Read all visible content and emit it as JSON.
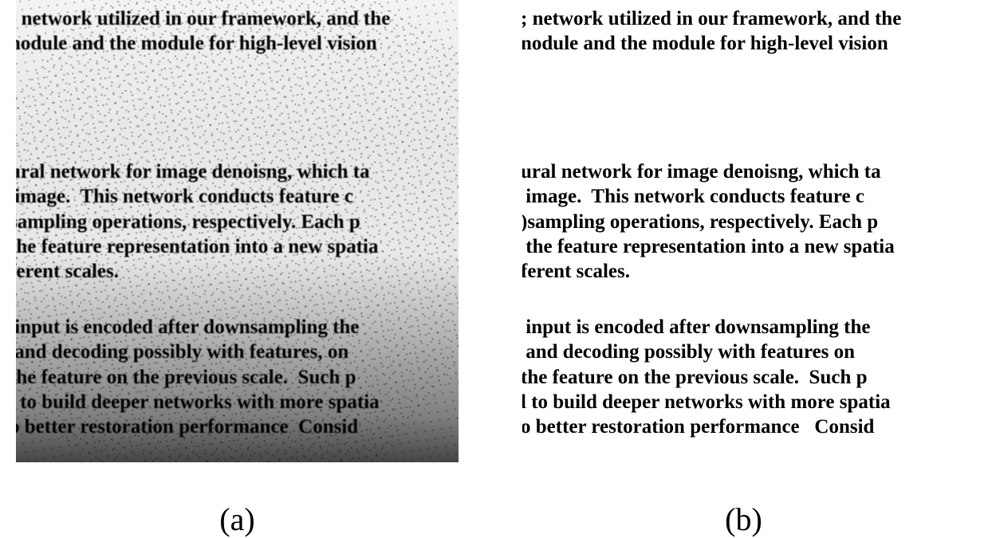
{
  "panel_a": {
    "block1": "; network utilized in our framework, and the\nnodule and the module for high-level vision",
    "block2": "ural network for image denoisng, which ta\n image.  This network conducts feature c\nsampling operations, respectively. Each p\nthe feature representation into a new spatia\nferent scales.",
    "block3": " input is encoded after downsampling the\n and decoding possibly with features, on\nthe feature on the previous scale.  Such p\nl to build deeper networks with more spatia\no better restoration performance  Consid"
  },
  "panel_b": {
    "block1": "; network utilized in our framework, and the\nnodule and the module for high-level vision",
    "block2": "ural network for image denoisng, which ta\n image.  This network conducts feature c\n)sampling operations, respectively. Each p\n the feature representation into a new spatia\nferent scales.",
    "block3": " input is encoded after downsampling the\n and decoding possibly with features on\nthe feature on the previous scale.  Such p\nl to build deeper networks with more spatia\no better restoration performance   Consid"
  },
  "captions": {
    "a": "(a)",
    "b": "(b)"
  }
}
